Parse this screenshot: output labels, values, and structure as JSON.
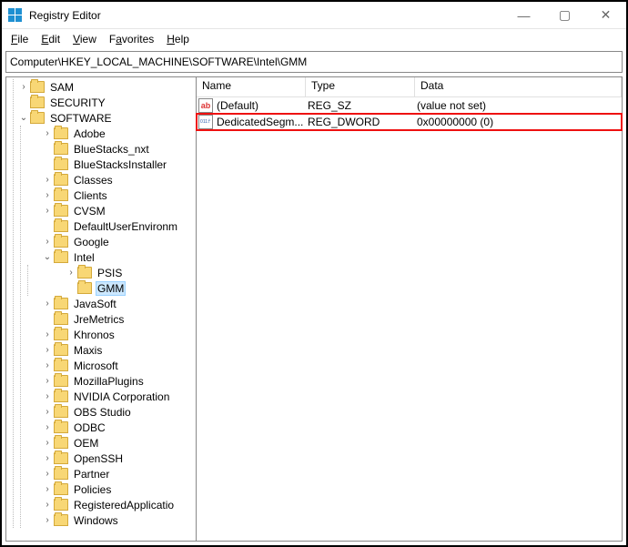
{
  "window": {
    "title": "Registry Editor"
  },
  "menu": {
    "file": "File",
    "edit": "Edit",
    "view": "View",
    "favorites": "Favorites",
    "help": "Help"
  },
  "address": "Computer\\HKEY_LOCAL_MACHINE\\SOFTWARE\\Intel\\GMM",
  "columns": {
    "name": "Name",
    "type": "Type",
    "data": "Data"
  },
  "values": [
    {
      "icon": "str",
      "name": "(Default)",
      "type": "REG_SZ",
      "data": "(value not set)",
      "highlight": false
    },
    {
      "icon": "bin",
      "name": "DedicatedSegm...",
      "type": "REG_DWORD",
      "data": "0x00000000 (0)",
      "highlight": true
    }
  ],
  "tree": {
    "root_children": [
      {
        "label": "SAM",
        "depth": 2,
        "expander": ">"
      },
      {
        "label": "SECURITY",
        "depth": 2,
        "expander": ""
      },
      {
        "label": "SOFTWARE",
        "depth": 2,
        "expander": "v",
        "children": [
          {
            "label": "Adobe",
            "depth": 3,
            "expander": ">"
          },
          {
            "label": "BlueStacks_nxt",
            "depth": 3,
            "expander": ""
          },
          {
            "label": "BlueStacksInstaller",
            "depth": 3,
            "expander": ""
          },
          {
            "label": "Classes",
            "depth": 3,
            "expander": ">"
          },
          {
            "label": "Clients",
            "depth": 3,
            "expander": ">"
          },
          {
            "label": "CVSM",
            "depth": 3,
            "expander": ">"
          },
          {
            "label": "DefaultUserEnvironm",
            "depth": 3,
            "expander": ""
          },
          {
            "label": "Google",
            "depth": 3,
            "expander": ">"
          },
          {
            "label": "Intel",
            "depth": 3,
            "expander": "v",
            "children": [
              {
                "label": "PSIS",
                "depth": 4,
                "expander": ">"
              },
              {
                "label": "GMM",
                "depth": 4,
                "expander": "",
                "selected": true
              }
            ]
          },
          {
            "label": "JavaSoft",
            "depth": 3,
            "expander": ">"
          },
          {
            "label": "JreMetrics",
            "depth": 3,
            "expander": ""
          },
          {
            "label": "Khronos",
            "depth": 3,
            "expander": ">"
          },
          {
            "label": "Maxis",
            "depth": 3,
            "expander": ">"
          },
          {
            "label": "Microsoft",
            "depth": 3,
            "expander": ">"
          },
          {
            "label": "MozillaPlugins",
            "depth": 3,
            "expander": ">"
          },
          {
            "label": "NVIDIA Corporation",
            "depth": 3,
            "expander": ">"
          },
          {
            "label": "OBS Studio",
            "depth": 3,
            "expander": ">"
          },
          {
            "label": "ODBC",
            "depth": 3,
            "expander": ">"
          },
          {
            "label": "OEM",
            "depth": 3,
            "expander": ">"
          },
          {
            "label": "OpenSSH",
            "depth": 3,
            "expander": ">"
          },
          {
            "label": "Partner",
            "depth": 3,
            "expander": ">"
          },
          {
            "label": "Policies",
            "depth": 3,
            "expander": ">"
          },
          {
            "label": "RegisteredApplicatio",
            "depth": 3,
            "expander": ">"
          },
          {
            "label": "Windows",
            "depth": 3,
            "expander": ">"
          }
        ]
      }
    ]
  }
}
